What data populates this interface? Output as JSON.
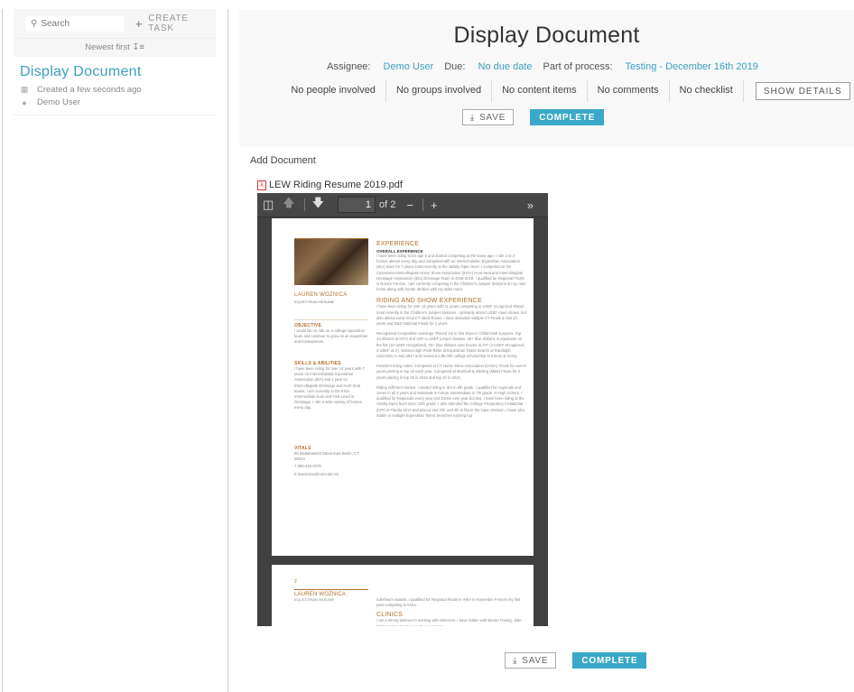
{
  "sidebar": {
    "search_placeholder": "Search",
    "create_task_label": "CREATE TASK",
    "sort_label": "Newest first",
    "tasks": [
      {
        "title": "Display Document",
        "created": "Created a few seconds ago",
        "user": "Demo User"
      }
    ]
  },
  "header": {
    "title": "Display Document",
    "assignee_label": "Assignee:",
    "assignee_value": "Demo User",
    "due_label": "Due:",
    "due_value": "No due date",
    "process_label": "Part of process:",
    "process_value": "Testing - December 16th 2019",
    "info": [
      "No people involved",
      "No groups involved",
      "No content items",
      "No comments",
      "No checklist"
    ],
    "show_details_label": "SHOW DETAILS",
    "save_label": "SAVE",
    "complete_label": "COMPLETE"
  },
  "content": {
    "section_label": "Add Document",
    "file_name": "LEW Riding Resume 2019.pdf"
  },
  "viewer": {
    "current_page": "1",
    "page_count_label": "of 2",
    "page1": {
      "name": "LAUREN WOZNICA",
      "subtitle": "EQUESTRIAN RESUME",
      "objective_heading": "OBJECTIVE",
      "objective_text": "I would like to ride on a college equestrian team and continue to grow as an equestrian and horsewoman.",
      "skills_heading": "SKILLS & ABILITIES",
      "skills_text": "I have been riding for over 14 years with 7 years on Interscholastic Equestrian Association (IEA) and 1 year on Intercollegiate Dressage and Hunt Seat teams. I am currently at the IHSA Intermediate level and First Level in Dressage. I ride a wide variety of horses every day.",
      "vitals_heading": "VITALS",
      "vitals_address": "68 Mattabassett Street East Berlin, CT 06023",
      "vitals_phone": "T 860-416-0375",
      "vitals_email": "E lewoznica@comcast.net",
      "experience_heading": "EXPERIENCE",
      "overall_heading": "OVERALL EXPERIENCE",
      "overall_text": "I have been riding since age 5 and started competing at the same age. I ride 2 to 3 horses almost every day and competed with an Interscholastic Equestrian Association (IEA) team for 7 years most recently at the Varsity Open level. I competed on the Cazenovia Intercollegiate Horse Show Association (IHSA) Hunt Seat and Intercollegiate Dressage Association (IDA) Dressage Team in 2018-2019. I qualified for Regional Finals in Novice Fences. I am currently competing in the Children's Jumper divisions on my own horse along with hunter derbies with my older mare.",
      "riding_heading": "RIDING AND SHOW EXPERIENCE",
      "riding_text": "I have been riding for over 14 years with 11 years competing in USEF recognized shows most recently in the Children's Jumper divisions. I primarily attend USEF rated shows, but also attend some local CT rated shows. I have attended multiple CT Finals in last 10 years and M&S National Finals for 3 years.",
      "wins_text": "Recognized Competition winnings: Placed 1st in first show in Child/Adult Jumpers. Top 10 ribbons at HITS and VSF in USEF jumper classes. 35+ blue ribbons in equitation on the flat (10 USEF recognized). 20+ blue ribbons over fences at 2'6\" (4 USEF recognized, 3 USEF at 2'). Named High Point Rider at Equestrian Talent Search at Randolph University in July 2017 and received a $5,000 college scholarship to Emory & Henry.",
      "pertinent_text": "Pertinent riding notes: Competed at CT Horse Show Association (CHSA) Finals for over 9 years pinning in top 10 each year. Competed at Marshall & Sterling (M&S) Finals for 3 years placing in top 15 in 2015 and top 10 in 2016.",
      "different_text": "Riding Different Horses: I started riding in IEA in 6th grade. I qualified for regionals and zones in all 3 years and Nationals in Future Intermediate in 7th grade. In High School, I qualified for Regionals every year and Zones ever year but two. I have been riding at the Varsity Open level since 10th grade. I also attended the College Preparatory Invitational (CPI) in Florida 2017 and placed 2nd O/F and 4th in flat in the Open Division. I have also ridden in multiple Equestrian Talent Searches earning top"
    },
    "page2": {
      "page_number": "2",
      "name": "LAUREN WOZNICA",
      "subtitle": "EQUESTRIAN RESUME",
      "continued_text": "rider/team awards. I qualified for Regional Finals in IHSA in November Fences my first year competing in IHSA.",
      "clinics_heading": "CLINICS",
      "clinics_text": "I am a strong believer in working with clinicians. I have ridden with Bernie Traurig, Julie Winkel, Nona Garson, Linda Langmeier"
    }
  },
  "footer": {
    "save_label": "SAVE",
    "complete_label": "COMPLETE"
  },
  "colors": {
    "accent": "#3aa8c8",
    "link": "#3a9fc2",
    "resume_accent": "#b07030"
  }
}
